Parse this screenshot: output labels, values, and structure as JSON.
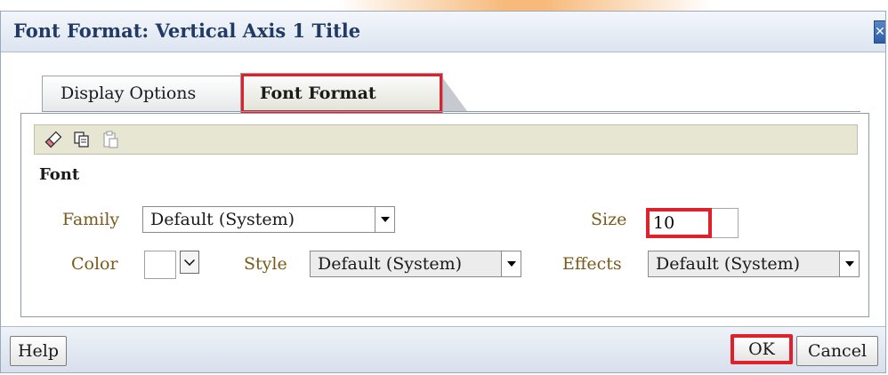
{
  "dialog": {
    "title": "Font Format: Vertical Axis 1 Title",
    "close_icon": "close-icon"
  },
  "tabs": [
    {
      "label": "Display Options",
      "selected": false
    },
    {
      "label": "Font Format",
      "selected": true
    }
  ],
  "toolbar": {
    "icons": [
      "eraser-icon",
      "copy-icon",
      "paste-icon"
    ]
  },
  "font": {
    "section_label": "Font",
    "family_label": "Family",
    "family_value": "Default (System)",
    "size_label": "Size",
    "size_value": "10",
    "color_label": "Color",
    "style_label": "Style",
    "style_value": "Default (System)",
    "effects_label": "Effects",
    "effects_value": "Default (System)"
  },
  "footer": {
    "help_label": "Help",
    "ok_label": "OK",
    "cancel_label": "Cancel"
  },
  "colors": {
    "highlight": "#e0202b",
    "title_text": "#213a63",
    "field_label": "#7a5a1a",
    "toolbar_bg": "#e6e6d2"
  }
}
